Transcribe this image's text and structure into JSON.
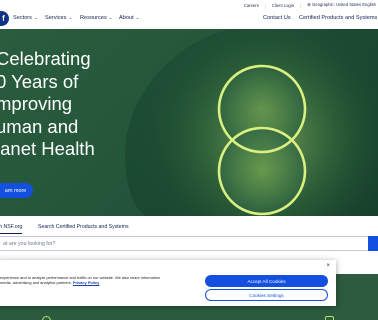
{
  "utility_bar": {
    "links": [
      "Careers",
      "Client Login"
    ],
    "language": "Geographic: United States English"
  },
  "nav": {
    "logo_text": "f",
    "items": [
      {
        "label": "Sectors"
      },
      {
        "label": "Services"
      },
      {
        "label": "Resources"
      },
      {
        "label": "About"
      }
    ],
    "right_links": [
      "Contact Us",
      "Certified Products and Systems"
    ]
  },
  "hero": {
    "title_lines": [
      "Celebrating",
      "0 Years of",
      "mproving",
      "uman and",
      "lanet Health"
    ],
    "button_label": "arn more"
  },
  "search": {
    "tabs": [
      "arch NSF.org",
      "Search Certified Products and Systems"
    ],
    "placeholder": "at are you looking for?"
  },
  "cookie_banner": {
    "text_line1": "experience and to analyze performance and traffic on our website. We also share information",
    "text_line2": "media, advertising and analytics partners.",
    "privacy_link": "Privacy Policy",
    "close": "×",
    "accept_label": "Accept All Cookies",
    "settings_label": "Cookies Settings"
  },
  "colors": {
    "primary_blue": "#1450e0",
    "hero_green": "#24563a",
    "lime_accent": "#b9e06a",
    "navy_text": "#10204d"
  }
}
